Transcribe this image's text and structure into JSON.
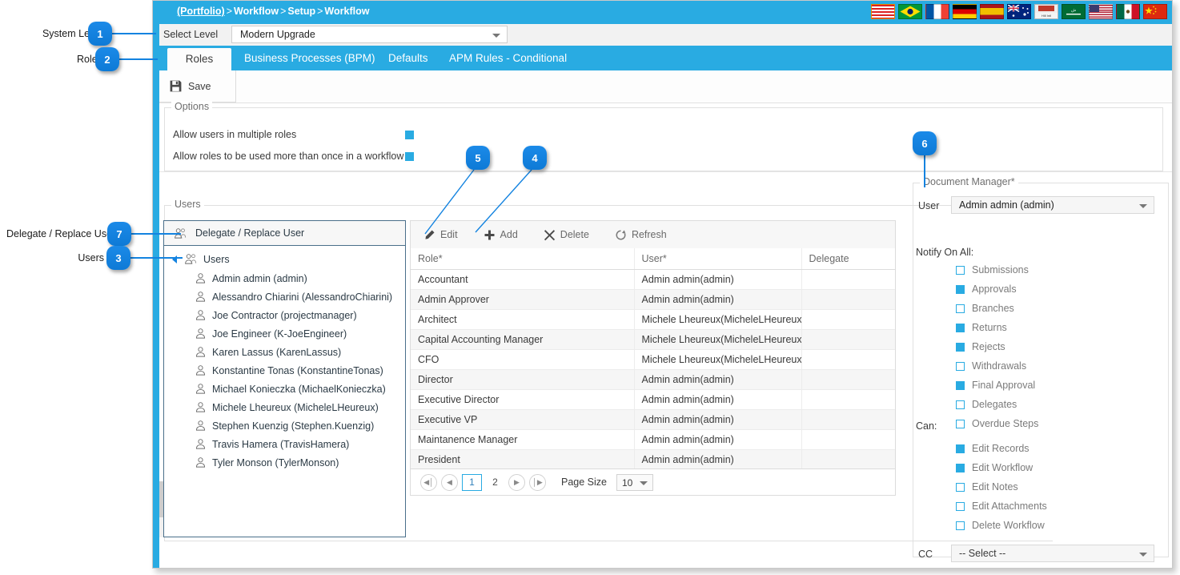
{
  "annotations": {
    "callouts": [
      {
        "num": "1",
        "label": "System Level"
      },
      {
        "num": "2",
        "label": "Roles"
      },
      {
        "num": "3",
        "label": "Users"
      },
      {
        "num": "4",
        "label": "Add"
      },
      {
        "num": "5",
        "label": "Edit"
      },
      {
        "num": "6",
        "label": "Document Manager"
      },
      {
        "num": "7",
        "label": "Delegate / Replace User"
      }
    ],
    "accent_color": "#1383e0"
  },
  "header": {
    "breadcrumb": [
      "(Portfolio)",
      "Workflow",
      "Setup",
      "Workflow"
    ],
    "separator": ">",
    "background": "#29abe2",
    "flags": [
      "usa-striped-flag-icon",
      "brazil-flag-icon",
      "france-flag-icon",
      "germany-flag-icon",
      "spain-flag-icon",
      "australia-flag-icon",
      "hill-international-flag-icon",
      "saudi-arabia-flag-icon",
      "usa-flag-icon",
      "mexico-flag-icon",
      "china-flag-icon"
    ]
  },
  "level_bar": {
    "label": "Select Level",
    "value": "Modern Upgrade",
    "placeholder": "Select Level"
  },
  "tabs": [
    {
      "label": "Roles",
      "active": true
    },
    {
      "label": "Business Processes (BPM)",
      "active": false
    },
    {
      "label": "Defaults",
      "active": false
    },
    {
      "label": "APM Rules - Conditional",
      "active": false
    }
  ],
  "toolbar": {
    "save_label": "Save",
    "save_icon": "floppy-disk-icon"
  },
  "options": {
    "legend": "Options",
    "items": [
      {
        "label": "Allow users in multiple roles",
        "checked": true
      },
      {
        "label": "Allow roles to be used more than once in a workflow",
        "checked": true
      }
    ]
  },
  "users_group": {
    "legend": "Users",
    "tree_header": "Delegate / Replace User",
    "tree_root": "Users",
    "tree_items": [
      "Admin admin (admin)",
      "Alessandro Chiarini (AlessandroChiarini)",
      "Joe Contractor (projectmanager)",
      "Joe Engineer (K-JoeEngineer)",
      "Karen Lassus (KarenLassus)",
      "Konstantine Tonas (KonstantineTonas)",
      "Michael Konieczka (MichaelKonieczka)",
      "Michele Lheureux (MicheleLHeureux)",
      "Stephen Kuenzig (Stephen.Kuenzig)",
      "Travis Hamera (TravisHamera)",
      "Tyler Monson (TylerMonson)"
    ]
  },
  "grid": {
    "actions": [
      {
        "label": "Edit",
        "icon": "pencil-icon"
      },
      {
        "label": "Add",
        "icon": "plus-icon"
      },
      {
        "label": "Delete",
        "icon": "x-icon"
      },
      {
        "label": "Refresh",
        "icon": "refresh-icon"
      }
    ],
    "columns": [
      "Role*",
      "User*",
      "Delegate"
    ],
    "rows": [
      [
        "Accountant",
        "Admin admin(admin)",
        ""
      ],
      [
        "Admin Approver",
        "Admin admin(admin)",
        ""
      ],
      [
        "Architect",
        "Michele Lheureux(MicheleLHeureux)",
        ""
      ],
      [
        "Capital Accounting Manager",
        "Michele Lheureux(MicheleLHeureux)",
        ""
      ],
      [
        "CFO",
        "Michele Lheureux(MicheleLHeureux)",
        ""
      ],
      [
        "Director",
        "Admin admin(admin)",
        ""
      ],
      [
        "Executive Director",
        "Admin admin(admin)",
        ""
      ],
      [
        "Executive VP",
        "Admin admin(admin)",
        ""
      ],
      [
        "Maintanence Manager",
        "Admin admin(admin)",
        ""
      ],
      [
        "President",
        "Admin admin(admin)",
        ""
      ]
    ],
    "pager": {
      "first": "first-page-icon",
      "prev": "previous-page-icon",
      "pages": [
        "1",
        "2"
      ],
      "current_page": "1",
      "next": "next-page-icon",
      "last": "last-page-icon",
      "page_size_label": "Page Size",
      "page_size_value": "10"
    }
  },
  "document_manager": {
    "legend": "Document Manager*",
    "user_label": "User",
    "user_value": "Admin admin (admin)",
    "notify_title": "Notify On All:",
    "notify_items": [
      {
        "label": "Submissions",
        "checked": false
      },
      {
        "label": "Approvals",
        "checked": true
      },
      {
        "label": "Branches",
        "checked": false
      },
      {
        "label": "Returns",
        "checked": true
      },
      {
        "label": "Rejects",
        "checked": true
      },
      {
        "label": "Withdrawals",
        "checked": false
      },
      {
        "label": "Final Approval",
        "checked": true
      },
      {
        "label": "Delegates",
        "checked": false
      },
      {
        "label": "Overdue Steps",
        "checked": false
      }
    ],
    "can_title": "Can:",
    "can_items": [
      {
        "label": "Edit Records",
        "checked": true
      },
      {
        "label": "Edit Workflow",
        "checked": true
      },
      {
        "label": "Edit Notes",
        "checked": false
      },
      {
        "label": "Edit Attachments",
        "checked": false
      },
      {
        "label": "Delete Workflow",
        "checked": false
      }
    ],
    "cc_label": "CC",
    "cc_value": "-- Select --"
  }
}
